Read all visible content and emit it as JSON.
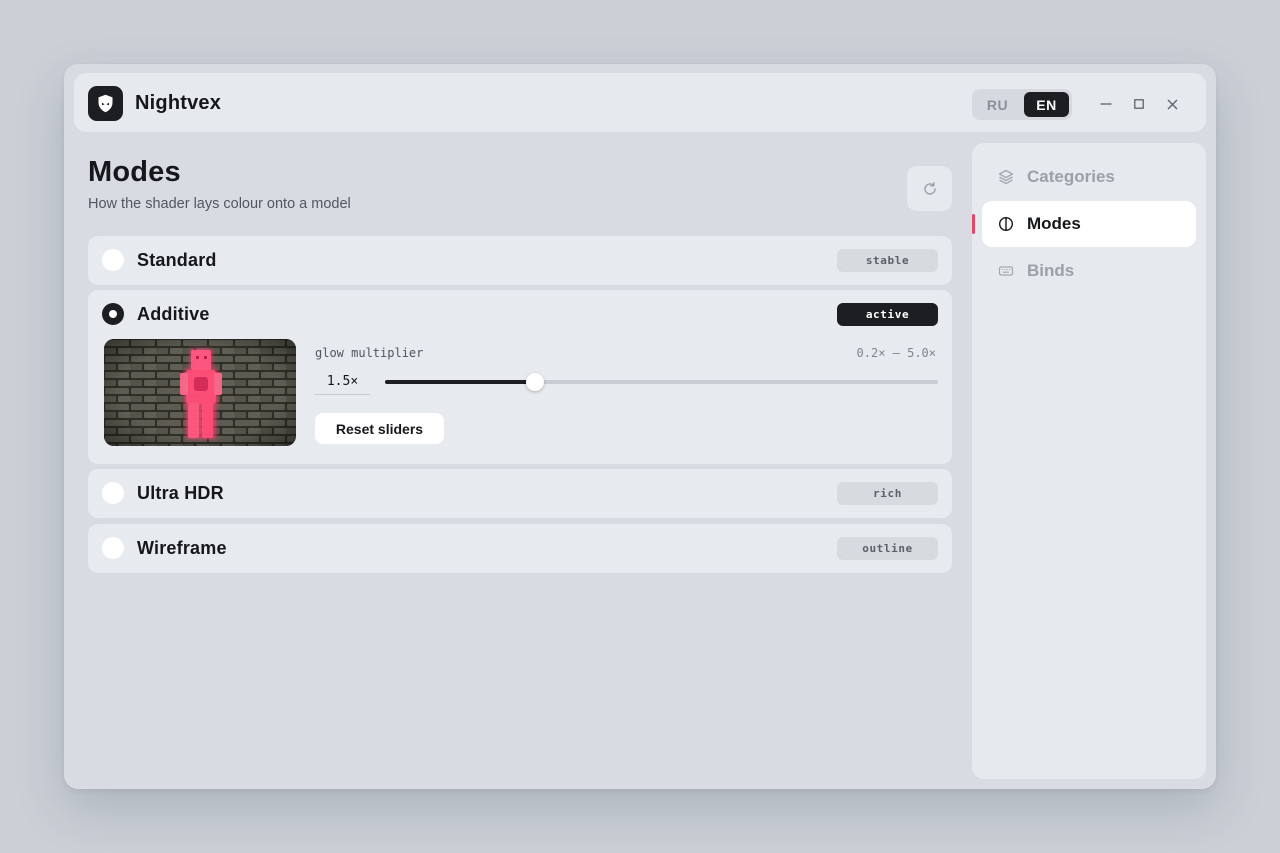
{
  "app": {
    "name": "Nightvex"
  },
  "language": {
    "options": [
      "RU",
      "EN"
    ],
    "selected": "EN"
  },
  "page": {
    "title": "Modes",
    "subtitle": "How the shader lays colour onto a model"
  },
  "modes": [
    {
      "name": "Standard",
      "tag": "stable",
      "selected": false
    },
    {
      "name": "Additive",
      "tag": "active",
      "selected": true,
      "slider": {
        "label": "glow multiplier",
        "range_label": "0.2× – 5.0×",
        "value_label": "1.5×",
        "min": 0.2,
        "max": 5.0,
        "value": 1.5
      },
      "reset_label": "Reset sliders"
    },
    {
      "name": "Ultra HDR",
      "tag": "rich",
      "selected": false
    },
    {
      "name": "Wireframe",
      "tag": "outline",
      "selected": false
    }
  ],
  "sidebar": {
    "items": [
      {
        "label": "Categories",
        "icon": "layers-icon",
        "active": false
      },
      {
        "label": "Modes",
        "icon": "contrast-icon",
        "active": true
      },
      {
        "label": "Binds",
        "icon": "keyboard-icon",
        "active": false
      }
    ]
  },
  "colors": {
    "accent": "#e04a6c",
    "dark": "#1c1e22",
    "glow": "#ff3d6e"
  }
}
